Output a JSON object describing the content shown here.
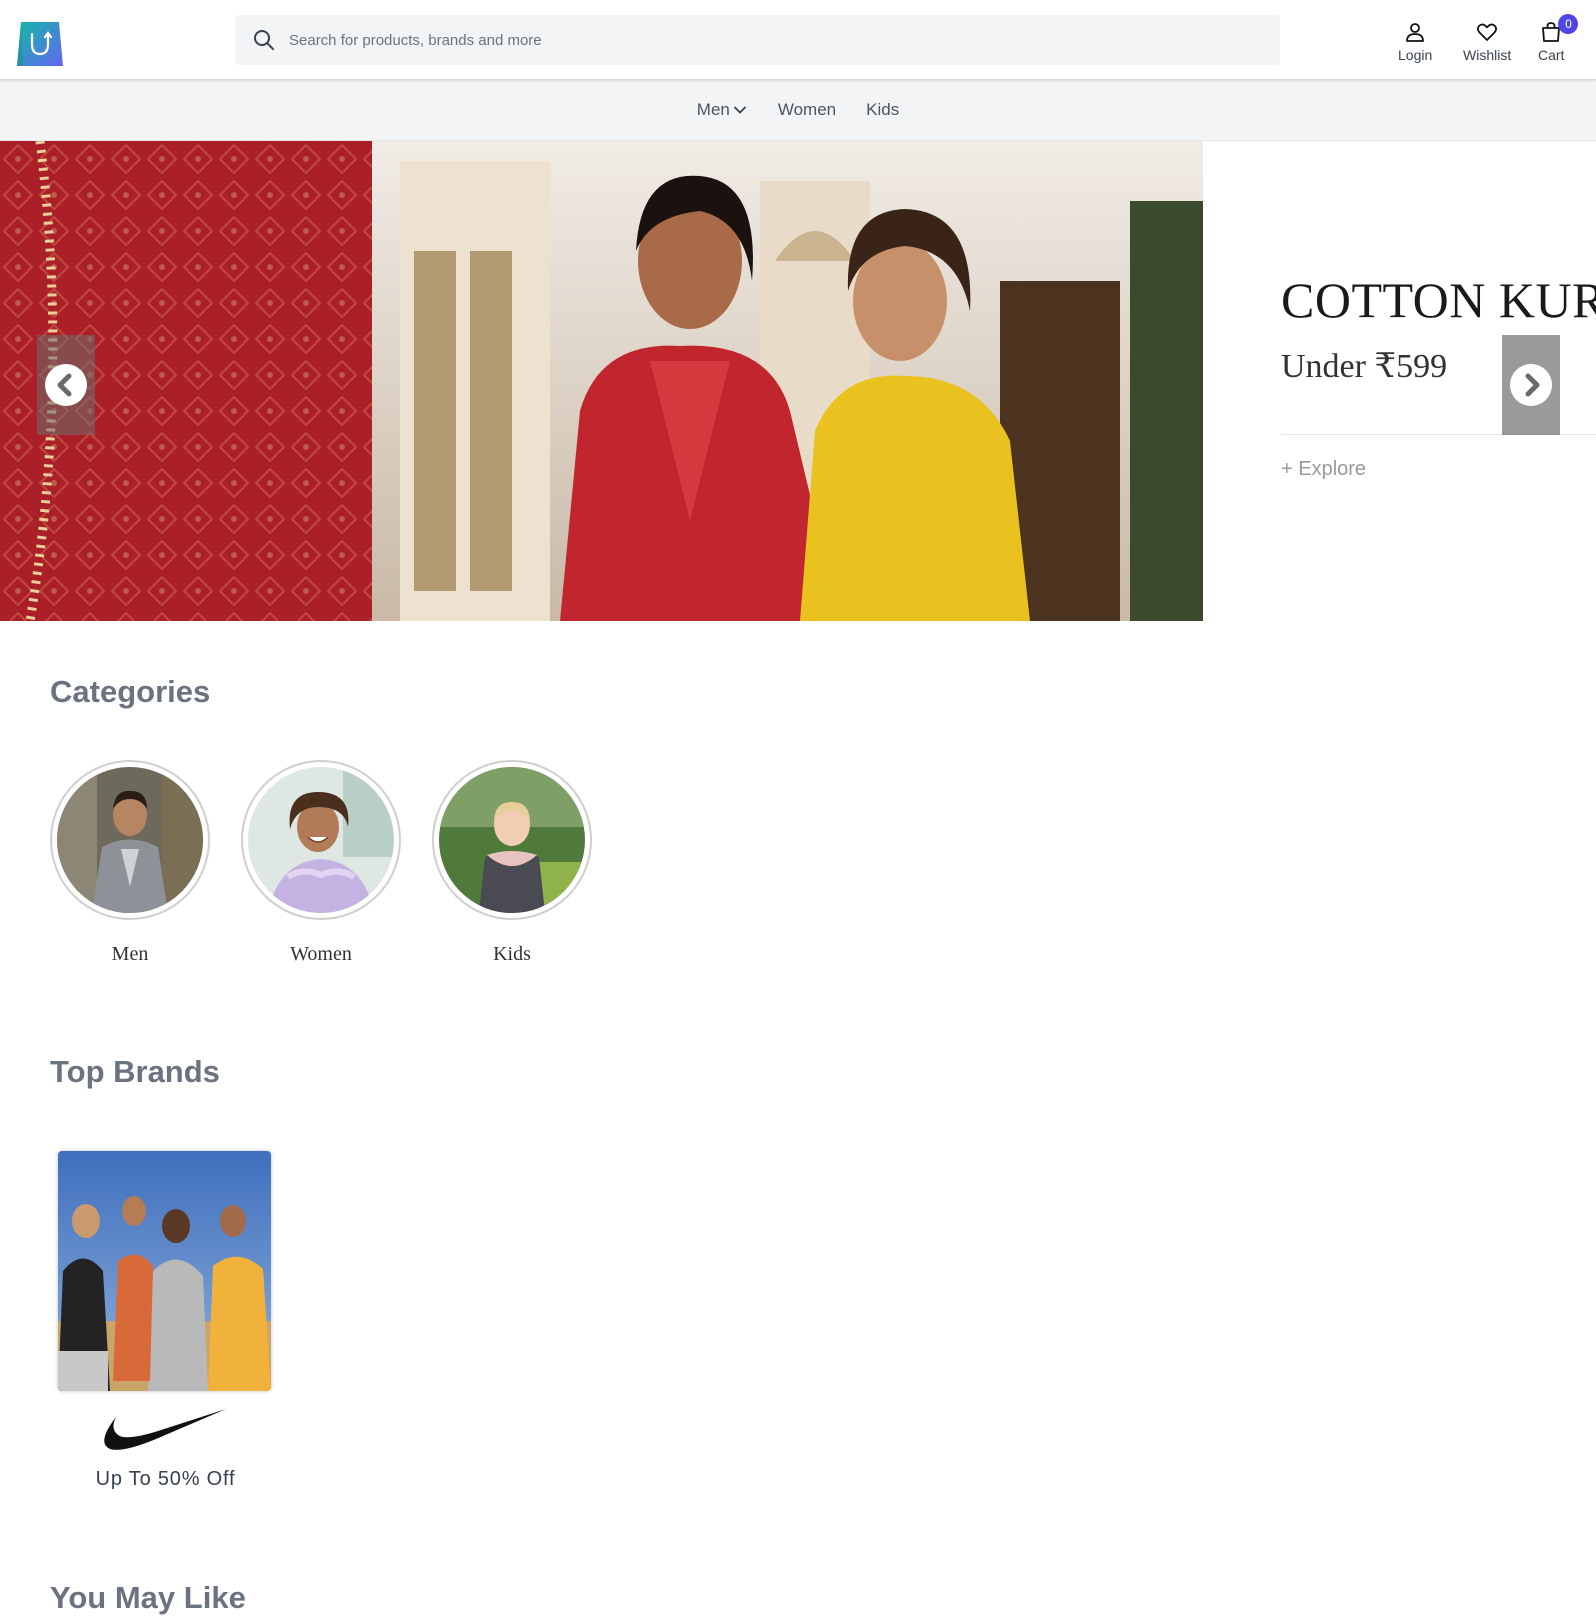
{
  "header": {
    "logo_icon": "shopping-bag-logo",
    "search_placeholder": "Search for products, brands and more",
    "actions": [
      {
        "label": "Login",
        "icon": "user-icon"
      },
      {
        "label": "Wishlist",
        "icon": "heart-icon"
      },
      {
        "label": "Cart",
        "icon": "bag-icon"
      }
    ],
    "cart_count": "0",
    "badge_color": "#4f46e5"
  },
  "nav": {
    "items": [
      {
        "label": "Men",
        "icon": "chevron-down-icon"
      },
      {
        "label": "Women"
      },
      {
        "label": "Kids"
      }
    ]
  },
  "hero": {
    "title": "COTTON KURTAS",
    "subtitle": "Under ₹599",
    "cta": "+ Explore",
    "prev_icon": "chevron-left-icon",
    "next_icon": "chevron-right-icon"
  },
  "categories": {
    "title": "Categories",
    "items": [
      {
        "label": "Men"
      },
      {
        "label": "Women"
      },
      {
        "label": "Kids"
      }
    ]
  },
  "top_brands": {
    "title": "Top Brands",
    "items": [
      {
        "logo": "nike-swoosh-logo",
        "offer": "Up To 50% Off"
      }
    ]
  },
  "you_may_like": {
    "title": "You May Like"
  }
}
